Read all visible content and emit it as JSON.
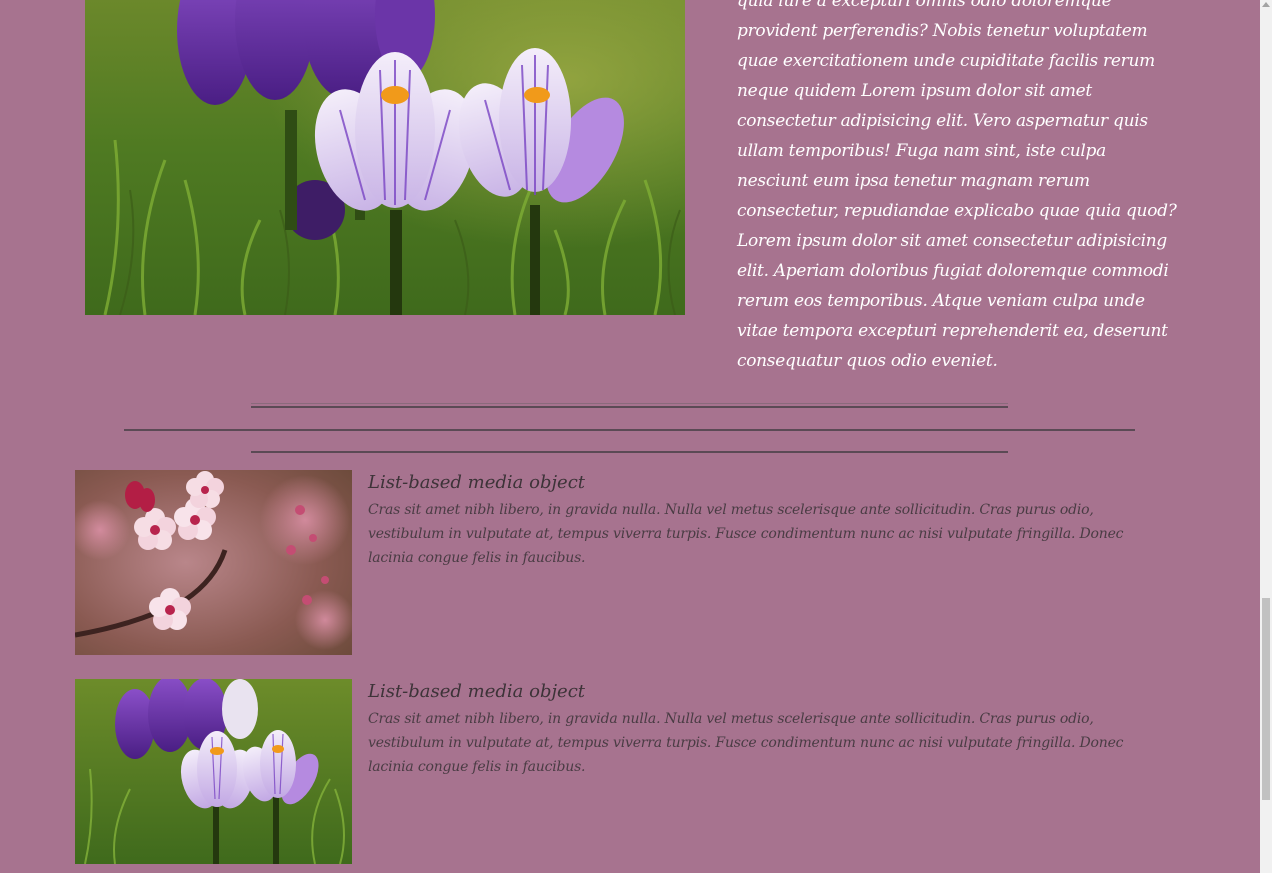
{
  "hero": {
    "image_alt": "Purple and white crocus flowers in grass",
    "paragraph": "quia iure a excepturi omnis odio doloremque provident perferendis? Nobis tenetur voluptatem quae exercitationem unde cupiditate facilis rerum neque quidem Lorem ipsum dolor sit amet consectetur adipisicing elit. Vero aspernatur quis ullam temporibus! Fuga nam sint, iste culpa nesciunt eum ipsa tenetur magnam rerum consectetur, repudiandae explicabo quae quia quod? Lorem ipsum dolor sit amet consectetur adipisicing elit. Aperiam doloribus fugiat doloremque commodi rerum eos temporibus. Atque veniam culpa unde vitae tempora excepturi reprehenderit ea, deserunt consequatur quos odio eveniet."
  },
  "media_list": [
    {
      "heading": "List-based media object",
      "text": "Cras sit amet nibh libero, in gravida nulla. Nulla vel metus scelerisque ante sollicitudin. Cras purus odio, vestibulum in vulputate at, tempus viverra turpis. Fusce condimentum nunc ac nisi vulputate fringilla. Donec lacinia congue felis in faucibus.",
      "image": "cherry-blossom-photo"
    },
    {
      "heading": "List-based media object",
      "text": "Cras sit amet nibh libero, in gravida nulla. Nulla vel metus scelerisque ante sollicitudin. Cras purus odio, vestibulum in vulputate at, tempus viverra turpis. Fusce condimentum nunc ac nisi vulputate fringilla. Donec lacinia congue felis in faucibus.",
      "image": "crocus-photo"
    }
  ],
  "colors": {
    "background": "#a7738f",
    "hero_text": "#ffffff",
    "divider": "#5b4a55",
    "media_heading": "#3d3338"
  }
}
